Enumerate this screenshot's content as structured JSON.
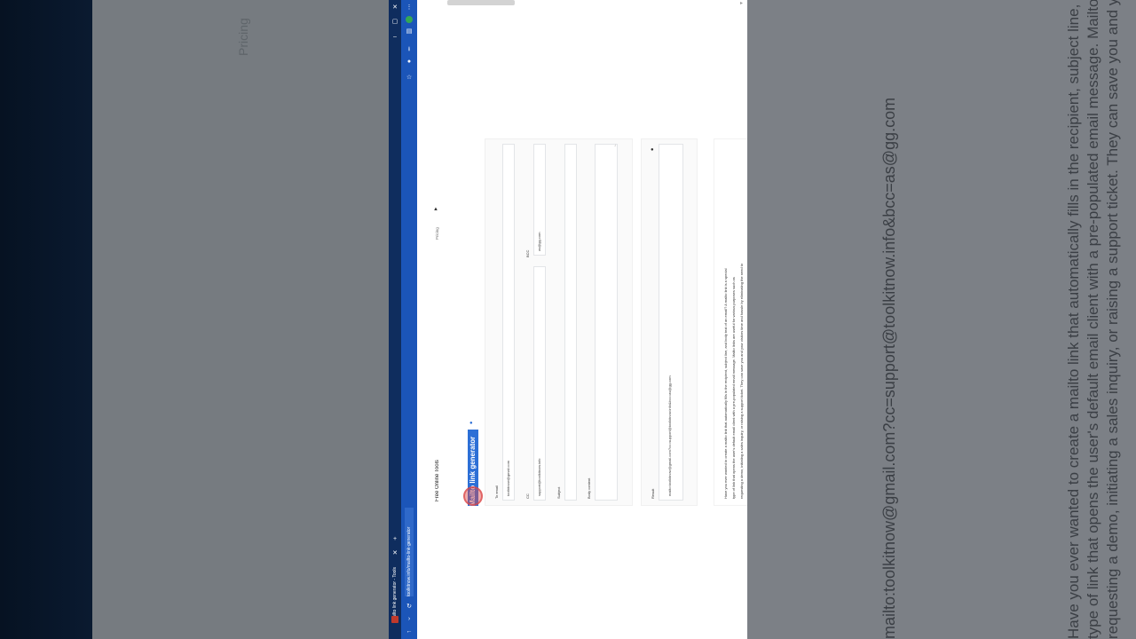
{
  "background": {
    "left_ghost_label": "Pricing",
    "right_ghost_lines": [
      "Have you ever wanted to create a mailto link that automatically fills in the recipient, subject line, and body text of an email",
      "type of link that opens the user's default email client with a pre-populated email message. Mailto links are useful for various",
      "requesting a demo, initiating a sales inquiry, or raising a support ticket. They can save you and your visitors time and has"
    ],
    "right_ghost_result": "mailto:toolkitnow@gmail.com?cc=support@toolkitnow.info&bcc=as@gg.com"
  },
  "browser": {
    "tab_title": "Mailto link generator - Tools",
    "address": "toolkitnow.info/mailto-link-generator",
    "icons": [
      "close-icon",
      "restore-icon",
      "minimize-icon",
      "extension-icon",
      "download-icon",
      "profile-icon",
      "star-icon",
      "back-icon",
      "reload-icon",
      "home-icon"
    ]
  },
  "site": {
    "brand": "Free Online Tools",
    "nav_pricing": "Pricing"
  },
  "tool": {
    "title": "Mailto link generator",
    "to_label": "To email",
    "to_value": "toolkitnow@gmail.com",
    "cc_label": "CC",
    "cc_value": "support@toolkitnow.info",
    "bcc_label": "BCC",
    "bcc_value": "as@gg.com",
    "subject_label": "Subject",
    "subject_value": "",
    "body_label": "Body content",
    "body_value": "",
    "result_label": "Result",
    "result_value": "mailto:toolkitnow@gmail.com?cc=support@toolkitnow.info&bcc=as@gg.com"
  },
  "description": {
    "lines": [
      "Have you ever wanted to create a mailto link that automatically fills in the recipient, subject line, and body text of an email? A mailto link is a special",
      "type of link that opens the user's default email client with a pre-populated email message. Mailto links are useful for various purposes such as",
      "requesting a demo, initiating a sales inquiry, or raising a support ticket. They can save you and your visitors time and hassle by eliminating the need to"
    ]
  }
}
